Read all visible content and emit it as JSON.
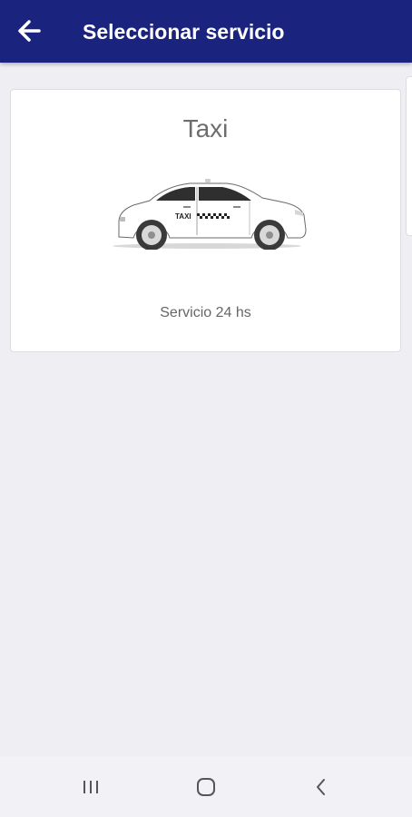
{
  "app_bar": {
    "title": "Seleccionar servicio",
    "background_color": "#1a237e",
    "back_icon": "arrow-left-icon"
  },
  "services": [
    {
      "title": "Taxi",
      "subtitle": "Servicio 24 hs",
      "image": "taxi-car",
      "image_text": "TAXI"
    }
  ],
  "nav_bar": {
    "recents_icon": "recent-apps-icon",
    "home_icon": "home-icon",
    "back_icon": "nav-back-icon"
  }
}
